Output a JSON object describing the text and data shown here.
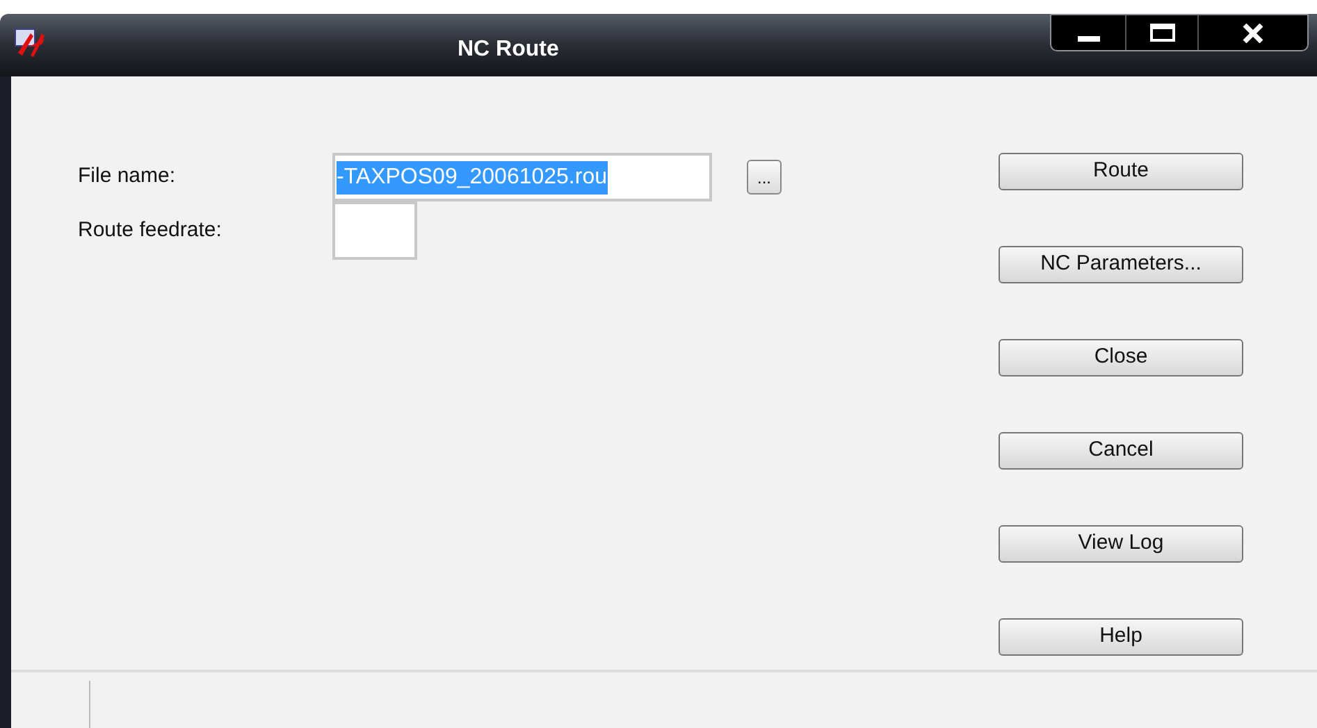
{
  "window": {
    "title": "NC Route"
  },
  "fields": [
    {
      "label": "File name:",
      "value": "-TAXPOS09_20061025.rou",
      "selected": true,
      "browse": "..."
    },
    {
      "label": "Route feedrate:"
    }
  ],
  "buttons": [
    "Route",
    "NC Parameters...",
    "Close",
    "Cancel",
    "View Log",
    "Help"
  ]
}
